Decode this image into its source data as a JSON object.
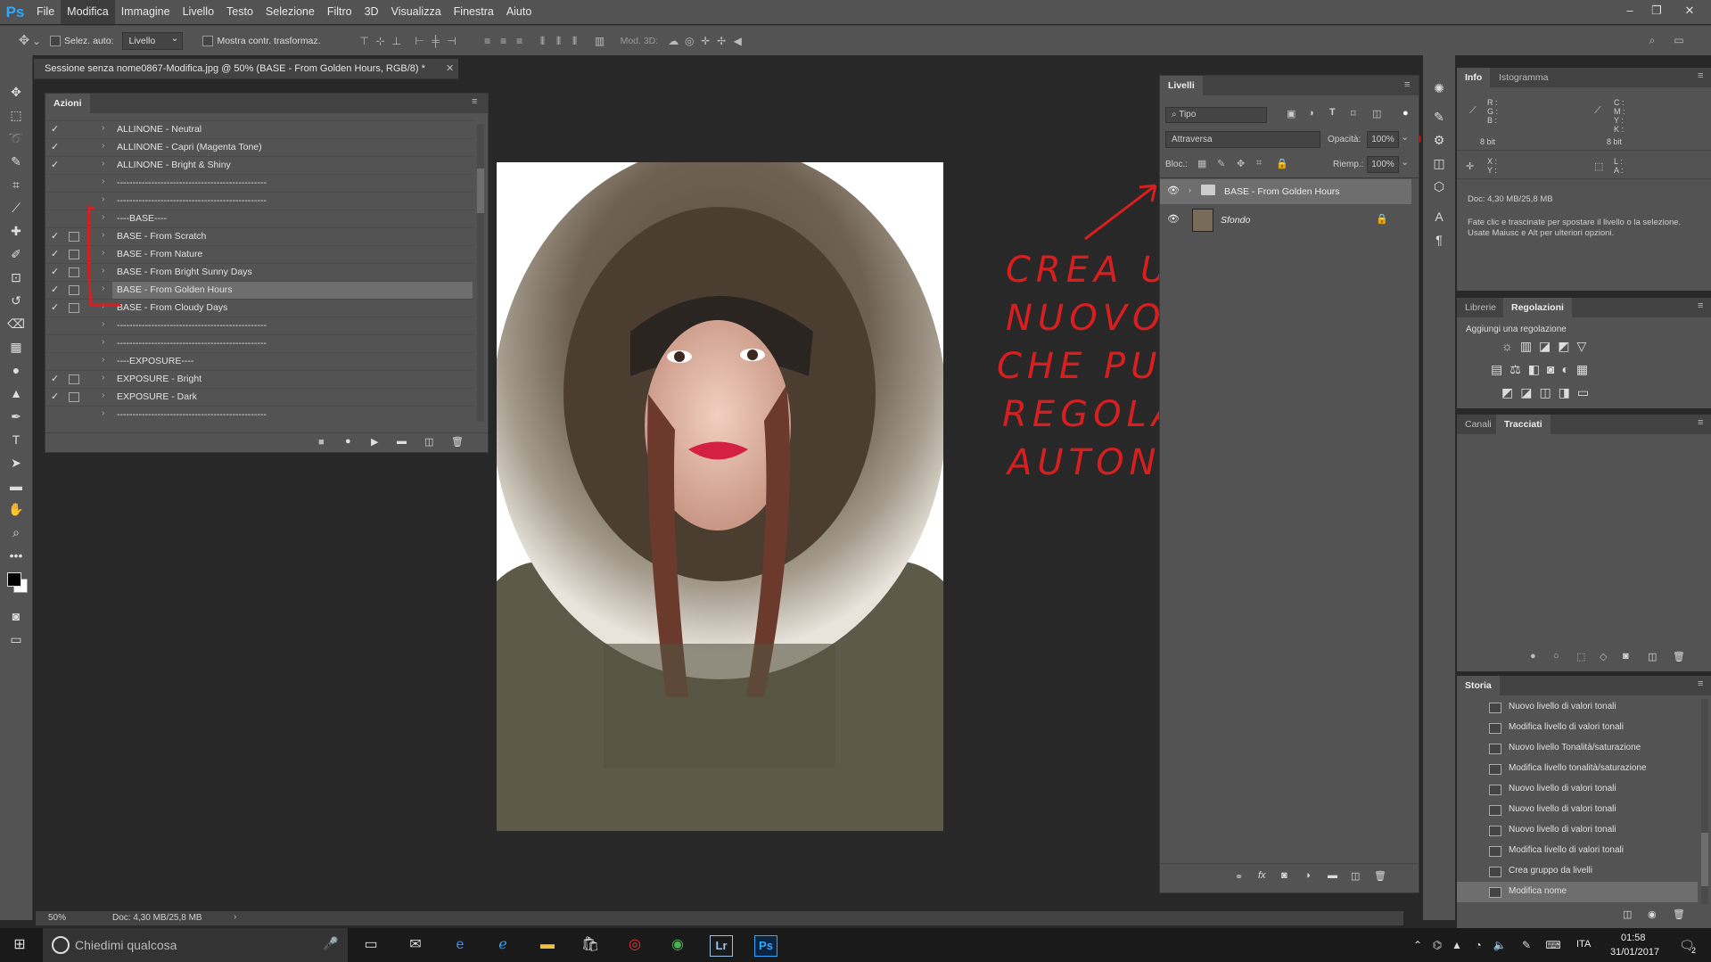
{
  "app": {
    "logo": "Ps"
  },
  "menu": [
    "File",
    "Modifica",
    "Immagine",
    "Livello",
    "Testo",
    "Selezione",
    "Filtro",
    "3D",
    "Visualizza",
    "Finestra",
    "Aiuto"
  ],
  "menu_active": "Modifica",
  "options": {
    "auto_select_label": "Selez. auto:",
    "auto_select_value": "Livello",
    "show_transform_label": "Mostra contr. trasformaz.",
    "mode3d_label": "Mod. 3D:"
  },
  "document": {
    "tab_title": "Sessione senza nome0867-Modifica.jpg @ 50% (BASE - From Golden Hours, RGB/8) *"
  },
  "actions_panel": {
    "tab": "Azioni",
    "rows": [
      {
        "label": "ALLINONE - Neutral",
        "checked": true,
        "dialog": false
      },
      {
        "label": "ALLINONE - Capri (Magenta Tone)",
        "checked": true,
        "dialog": false
      },
      {
        "label": "ALLINONE - Bright & Shiny",
        "checked": true,
        "dialog": false
      },
      {
        "label": "------------------------------------------------",
        "checked": false,
        "dialog": false
      },
      {
        "label": "------------------------------------------------",
        "checked": false,
        "dialog": false
      },
      {
        "label": "----BASE----",
        "checked": false,
        "dialog": false
      },
      {
        "label": "BASE - From Scratch",
        "checked": true,
        "dialog": true
      },
      {
        "label": "BASE - From Nature",
        "checked": true,
        "dialog": true
      },
      {
        "label": "BASE - From Bright Sunny Days",
        "checked": true,
        "dialog": true
      },
      {
        "label": "BASE - From Golden Hours",
        "checked": true,
        "dialog": true,
        "selected": true
      },
      {
        "label": "BASE - From Cloudy Days",
        "checked": true,
        "dialog": true
      },
      {
        "label": "------------------------------------------------",
        "checked": false,
        "dialog": false
      },
      {
        "label": "------------------------------------------------",
        "checked": false,
        "dialog": false
      },
      {
        "label": "----EXPOSURE----",
        "checked": false,
        "dialog": false
      },
      {
        "label": "EXPOSURE - Bright",
        "checked": true,
        "dialog": true
      },
      {
        "label": "EXPOSURE - Dark",
        "checked": true,
        "dialog": true
      },
      {
        "label": "------------------------------------------------",
        "checked": false,
        "dialog": false
      }
    ]
  },
  "layers_panel": {
    "tab": "Livelli",
    "filter_label": "Tipo",
    "blend_mode": "Attraversa",
    "opacity_label": "Opacità:",
    "opacity_value": "100%",
    "lock_label": "Bloc.:",
    "fill_label": "Riemp.:",
    "fill_value": "100%",
    "layers": [
      {
        "name": "BASE - From Golden Hours",
        "type": "group",
        "selected": true
      },
      {
        "name": "Sfondo",
        "type": "image",
        "locked": true
      }
    ]
  },
  "info_panel": {
    "tabs": [
      "Info",
      "Istogramma"
    ],
    "rgb_labels": [
      "R :",
      "G :",
      "B :"
    ],
    "cmyk_labels": [
      "C :",
      "M :",
      "Y :",
      "K :"
    ],
    "bits_left": "8 bit",
    "bits_right": "8 bit",
    "xy_labels": [
      "X :",
      "Y :"
    ],
    "la_labels": [
      "L :",
      "A :"
    ],
    "doc_size": "Doc: 4,30 MB/25,8 MB",
    "hint": "Fate clic e trascinate per spostare il livello o la selezione. Usate Maiusc e Alt per ulteriori opzioni."
  },
  "adjust_panel": {
    "tabs": [
      "Librerie",
      "Regolazioni"
    ],
    "title": "Aggiungi una regolazione"
  },
  "paths_panel": {
    "tabs": [
      "Canali",
      "Tracciati"
    ]
  },
  "history_panel": {
    "tab": "Storia",
    "items": [
      "Nuovo livello di valori tonali",
      "Modifica livello di valori tonali",
      "Nuovo livello Tonalità/saturazione",
      "Modifica livello tonalità/saturazione",
      "Nuovo livello di valori tonali",
      "Nuovo livello di valori tonali",
      "Nuovo livello di valori tonali",
      "Modifica livello di valori tonali",
      "Crea gruppo da livelli",
      "Modifica nome"
    ],
    "selected_index": 9
  },
  "status": {
    "zoom": "50%",
    "doc": "Doc: 4,30 MB/25,8 MB"
  },
  "annotation": [
    "CREA UN",
    "NUOVO LIVELLO",
    "CHE PUO' ESSERE",
    "REGOLATO IN",
    "AUTONOMIA"
  ],
  "taskbar": {
    "search_placeholder": "Chiedimi qualcosa",
    "lang": "ITA",
    "time": "01:58",
    "date": "31/01/2017",
    "notif": "2"
  },
  "colors": {
    "panel": "#535353",
    "canvas_bg": "#282828",
    "ps_blue": "#31a8ff",
    "annotation_red": "#d81e1e"
  }
}
